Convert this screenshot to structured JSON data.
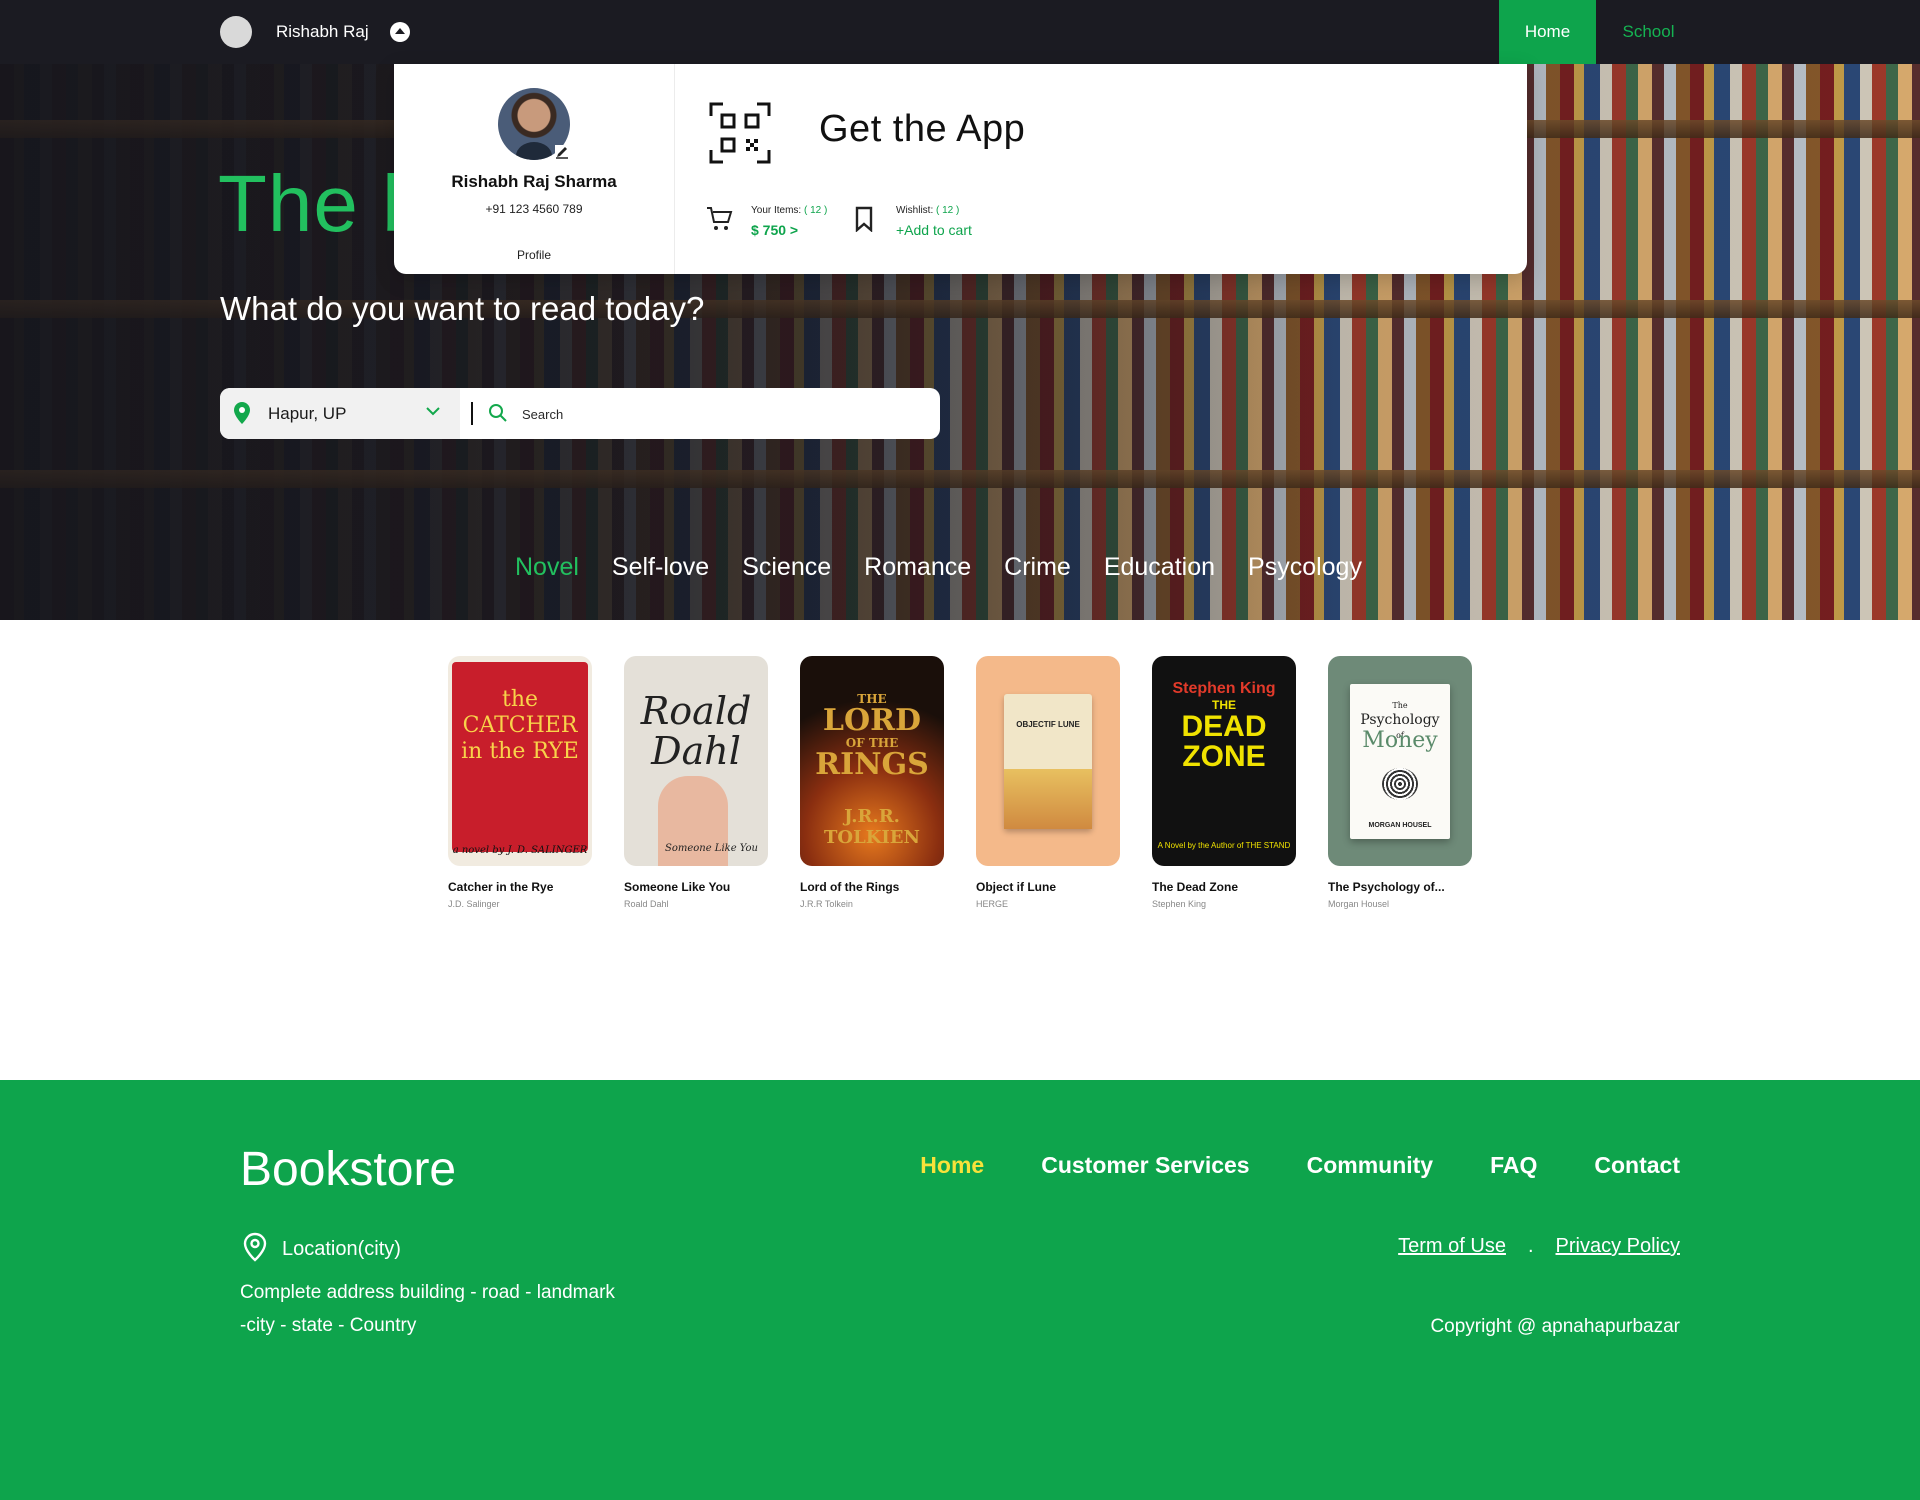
{
  "topbar": {
    "user_name": "Rishabh Raj",
    "nav": [
      {
        "label": "Home",
        "active": true
      },
      {
        "label": "School",
        "active": false
      }
    ]
  },
  "hero": {
    "title": "The b",
    "subtitle": "What do you want to read today?"
  },
  "search": {
    "location": "Hapur, UP",
    "placeholder": "Search"
  },
  "categories": [
    {
      "label": "Novel",
      "active": true
    },
    {
      "label": "Self-love",
      "active": false
    },
    {
      "label": "Science",
      "active": false
    },
    {
      "label": "Romance",
      "active": false
    },
    {
      "label": "Crime",
      "active": false
    },
    {
      "label": "Education",
      "active": false
    },
    {
      "label": "Psycology",
      "active": false
    }
  ],
  "dropdown": {
    "name": "Rishabh Raj Sharma",
    "phone": "+91 123 4560 789",
    "profile_link": "Profile",
    "app_title": "Get the App",
    "items_label": "Your Items:",
    "items_count": "( 12 )",
    "items_price": "$ 750 >",
    "wishlist_label": "Wishlist:",
    "wishlist_count": "( 12 )",
    "wishlist_action": "+Add to cart"
  },
  "books": [
    {
      "title": "Catcher in the Rye",
      "author": "J.D. Salinger",
      "cover_lines": [
        "the CATCHER",
        "in the RYE"
      ],
      "cover_sub": "a novel by J. D. SALINGER"
    },
    {
      "title": "Someone Like You",
      "author": "Roald Dahl",
      "cover_lines": [
        "Roald",
        "Dahl"
      ],
      "cover_sub": "Someone Like You"
    },
    {
      "title": "Lord of the Rings",
      "author": "J.R.R Tolkein",
      "cover_lines": [
        "THE",
        "LORD",
        "OF THE",
        "RINGS"
      ],
      "cover_sub": "J.R.R. TOLKIEN"
    },
    {
      "title": "Object if Lune",
      "author": "HERGE",
      "cover_lines": [
        "OBJECTIF LUNE"
      ],
      "cover_sub": ""
    },
    {
      "title": "The Dead Zone",
      "author": "Stephen King",
      "cover_lines": [
        "Stephen King",
        "THE",
        "DEAD",
        "ZONE"
      ],
      "cover_sub": "A Novel by the Author of THE STAND"
    },
    {
      "title": "The Psychology of...",
      "author": "Morgan Housel",
      "cover_lines": [
        "The",
        "Psychology",
        "of",
        "Money"
      ],
      "cover_sub": "MORGAN HOUSEL"
    }
  ],
  "footer": {
    "brand": "Bookstore",
    "nav": [
      {
        "label": "Home",
        "active": true
      },
      {
        "label": "Customer Services",
        "active": false
      },
      {
        "label": "Community",
        "active": false
      },
      {
        "label": "FAQ",
        "active": false
      },
      {
        "label": "Contact",
        "active": false
      }
    ],
    "location_title": "Location(city)",
    "address_line1": "Complete address building - road - landmark",
    "address_line2": "-city - state - Country",
    "links": [
      "Term of Use",
      "Privacy Policy"
    ],
    "separator": ".",
    "copyright": "Copyright @ apnahapurbazar"
  },
  "colors": {
    "accent_green": "#0ea44c",
    "hero_green": "#22c05f",
    "footer_active": "#f8e23a",
    "topbar_bg": "#1b1b22"
  },
  "icons": [
    "caret-up-icon",
    "map-pin-icon",
    "chevron-down-icon",
    "search-icon",
    "edit-icon",
    "qr-code-icon",
    "cart-icon",
    "bookmark-icon",
    "location-pin-icon"
  ]
}
